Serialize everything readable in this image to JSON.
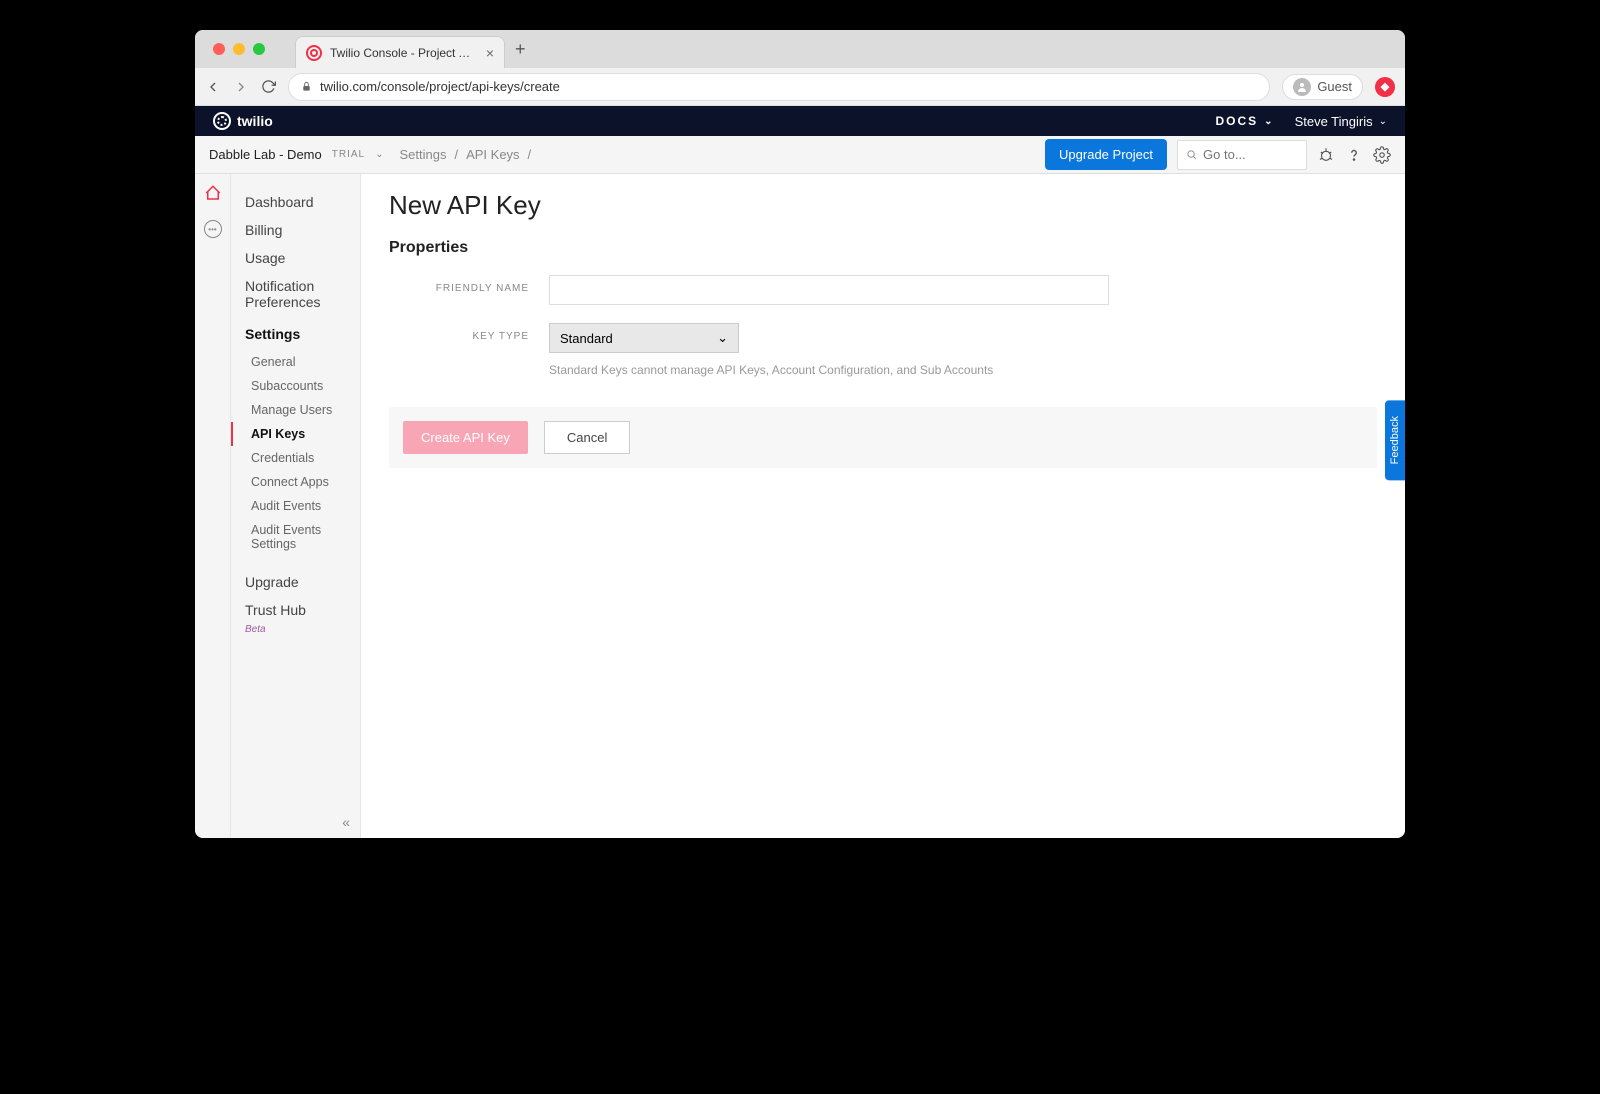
{
  "browser": {
    "tab_title": "Twilio Console - Project API Ke",
    "url": "twilio.com/console/project/api-keys/create",
    "guest_label": "Guest"
  },
  "topbar": {
    "logo_text": "twilio",
    "docs_label": "DOCS",
    "user_name": "Steve Tingiris"
  },
  "subheader": {
    "project_name": "Dabble Lab - Demo",
    "trial_label": "TRIAL",
    "breadcrumb": [
      "Settings",
      "API Keys"
    ],
    "upgrade_label": "Upgrade Project",
    "search_placeholder": "Go to..."
  },
  "sidenav": {
    "items": [
      {
        "label": "Dashboard"
      },
      {
        "label": "Billing"
      },
      {
        "label": "Usage"
      },
      {
        "label": "Notification Preferences"
      }
    ],
    "section_label": "Settings",
    "sub_items": [
      {
        "label": "General"
      },
      {
        "label": "Subaccounts"
      },
      {
        "label": "Manage Users"
      },
      {
        "label": "API Keys",
        "active": true
      },
      {
        "label": "Credentials"
      },
      {
        "label": "Connect Apps"
      },
      {
        "label": "Audit Events"
      },
      {
        "label": "Audit Events Settings"
      }
    ],
    "bottom_items": [
      {
        "label": "Upgrade"
      },
      {
        "label": "Trust Hub",
        "beta": true
      }
    ],
    "beta_label": "Beta"
  },
  "content": {
    "page_title": "New API Key",
    "section_title": "Properties",
    "friendly_name_label": "Friendly Name",
    "friendly_name_value": "",
    "key_type_label": "Key Type",
    "key_type_value": "Standard",
    "key_type_help": "Standard Keys cannot manage API Keys, Account Configuration, and Sub Accounts",
    "create_button": "Create API Key",
    "cancel_button": "Cancel"
  },
  "feedback_label": "Feedback"
}
